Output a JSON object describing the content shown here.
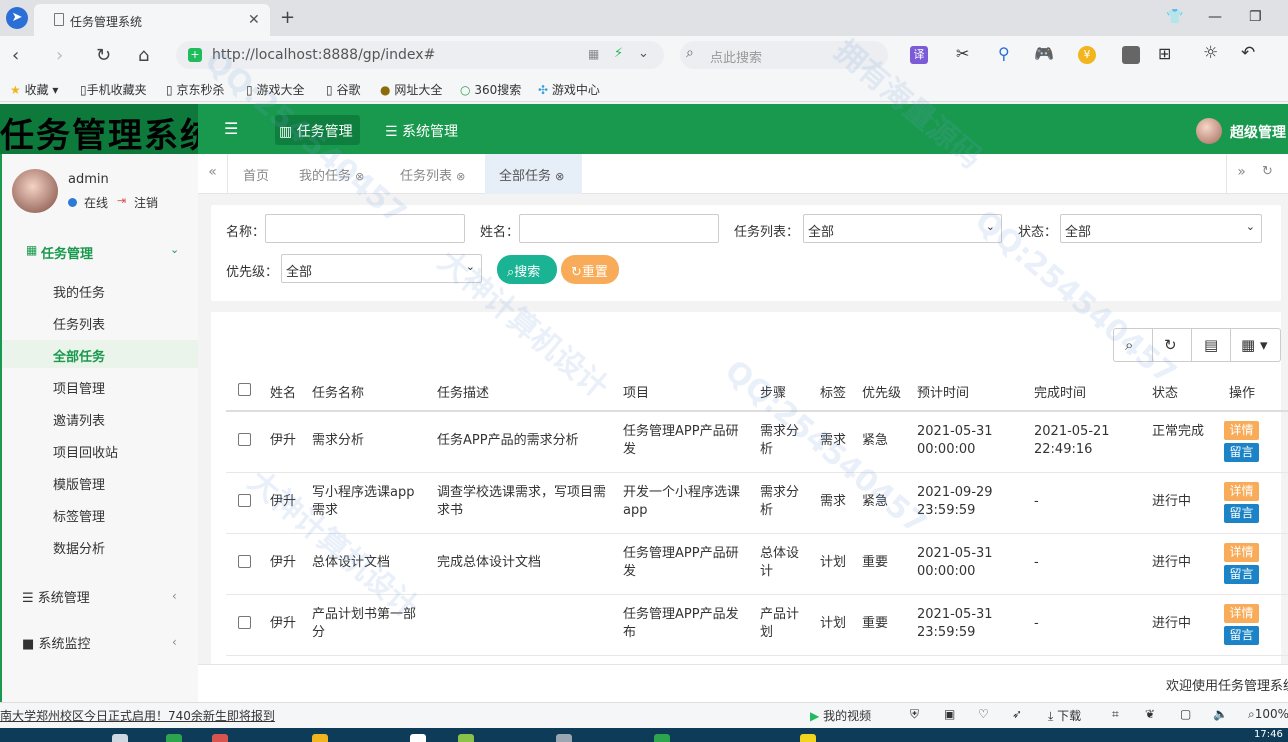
{
  "browser": {
    "tab_title": "任务管理系统",
    "tab_close": "✕",
    "new_tab": "+",
    "url": "http://localhost:8888/gp/index#",
    "search_placeholder": "点此搜索"
  },
  "bookmarks": [
    "收藏",
    "手机收藏夹",
    "京东秒杀",
    "游戏大全",
    "谷歌",
    "网址大全",
    "360搜索",
    "游戏中心"
  ],
  "header": {
    "logo": "任务管理系统",
    "nav_task": "任务管理",
    "nav_system": "系统管理",
    "user": "超级管理"
  },
  "sidebar": {
    "username": "admin",
    "status": "在线",
    "logout": "注销",
    "group_task": "任务管理",
    "items": [
      "我的任务",
      "任务列表",
      "全部任务",
      "项目管理",
      "邀请列表",
      "项目回收站",
      "模版管理",
      "标签管理",
      "数据分析"
    ],
    "group_system": "系统管理",
    "group_monitor": "系统监控"
  },
  "tabs": [
    "首页",
    "我的任务",
    "任务列表",
    "全部任务"
  ],
  "filters": {
    "name_label": "名称：",
    "person_label": "姓名：",
    "list_label": "任务列表：",
    "list_value": "全部",
    "status_label": "状态：",
    "status_value": "全部",
    "priority_label": "优先级：",
    "priority_value": "全部",
    "search_btn": "搜索",
    "reset_btn": "重置"
  },
  "table": {
    "headers": [
      "姓名",
      "任务名称",
      "任务描述",
      "项目",
      "步骤",
      "标签",
      "优先级",
      "预计时间",
      "完成时间",
      "状态",
      "操作"
    ],
    "detail_btn": "详情",
    "message_btn": "留言",
    "rows": [
      {
        "name": "伊升",
        "task": "需求分析",
        "desc": "任务APP产品的需求分析",
        "project": "任务管理APP产品研发",
        "step": "需求分析",
        "tag": "需求",
        "priority": "紧急",
        "plan": "2021-05-31 00:00:00",
        "done": "2021-05-21 22:49:16",
        "status": "正常完成"
      },
      {
        "name": "伊升",
        "task": "写小程序选课app需求",
        "desc": "调查学校选课需求，写项目需求书",
        "project": "开发一个小程序选课app",
        "step": "需求分析",
        "tag": "需求",
        "priority": "紧急",
        "plan": "2021-09-29 23:59:59",
        "done": "-",
        "status": "进行中"
      },
      {
        "name": "伊升",
        "task": "总体设计文档",
        "desc": "完成总体设计文档",
        "project": "任务管理APP产品研发",
        "step": "总体设计",
        "tag": "计划",
        "priority": "重要",
        "plan": "2021-05-31 00:00:00",
        "done": "-",
        "status": "进行中"
      },
      {
        "name": "伊升",
        "task": "产品计划书第一部分",
        "desc": "",
        "project": "任务管理APP产品发布",
        "step": "产品计划",
        "tag": "计划",
        "priority": "重要",
        "plan": "2021-05-31 23:59:59",
        "done": "-",
        "status": "进行中"
      }
    ]
  },
  "footer": "欢迎使用任务管理系统",
  "statusbar": {
    "news": "南大学郑州校区今日正式启用！740余新生即将报到",
    "video": "我的视频",
    "download": "下载",
    "zoom": "100%",
    "clock": "17:46"
  },
  "watermarks": [
    "QQ:254540457",
    "拥有海量源码",
    "大神计算机设计"
  ]
}
